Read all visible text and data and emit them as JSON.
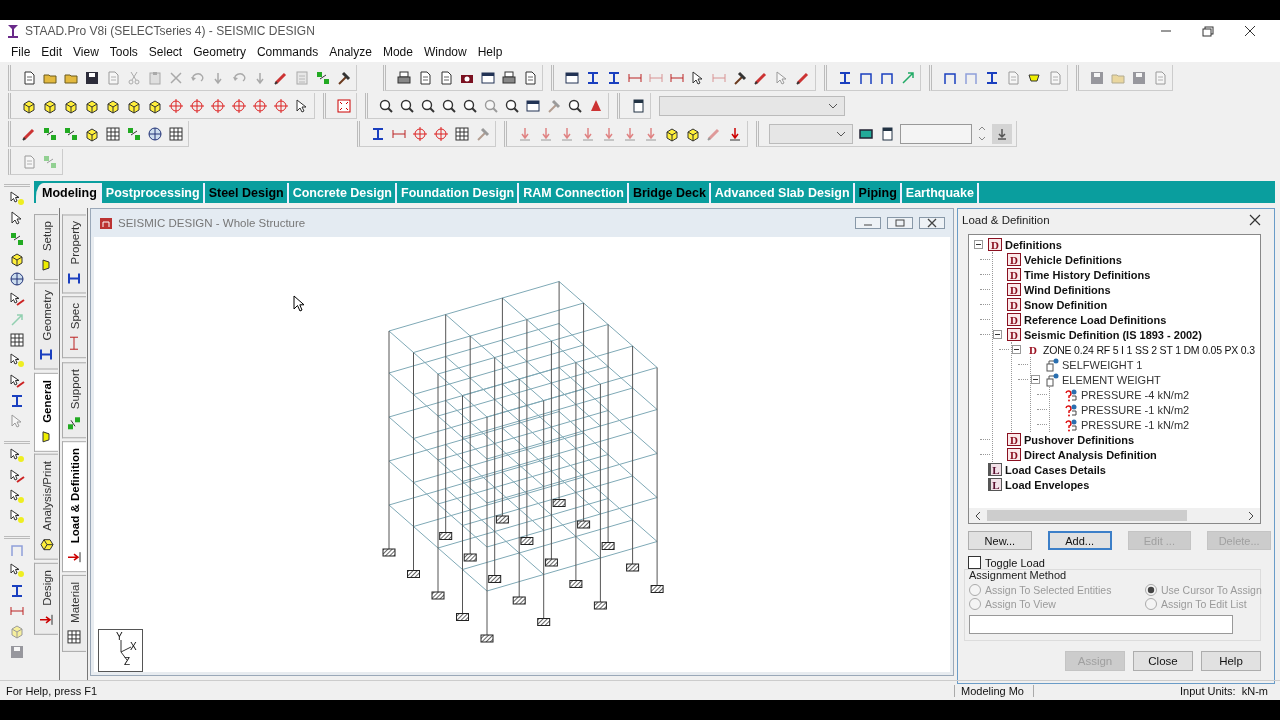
{
  "window": {
    "title": "STAAD.Pro V8i (SELECTseries 4) - SEISMIC DESIGN"
  },
  "menu": [
    "File",
    "Edit",
    "View",
    "Tools",
    "Select",
    "Geometry",
    "Commands",
    "Analyze",
    "Mode",
    "Window",
    "Help"
  ],
  "page_tabs": [
    {
      "label": "Modeling",
      "selected": true,
      "dark_label": true
    },
    {
      "label": "Postprocessing",
      "selected": false,
      "dark_label": false
    },
    {
      "label": "Steel Design",
      "selected": false,
      "dark_label": true
    },
    {
      "label": "Concrete Design",
      "selected": false,
      "dark_label": false
    },
    {
      "label": "Foundation Design",
      "selected": false,
      "dark_label": false
    },
    {
      "label": "RAM Connection",
      "selected": false,
      "dark_label": false
    },
    {
      "label": "Bridge Deck",
      "selected": false,
      "dark_label": true
    },
    {
      "label": "Advanced Slab Design",
      "selected": false,
      "dark_label": false
    },
    {
      "label": "Piping",
      "selected": false,
      "dark_label": true
    },
    {
      "label": "Earthquake",
      "selected": false,
      "dark_label": false
    }
  ],
  "mode_tabs": [
    {
      "label": "Setup",
      "selected": false
    },
    {
      "label": "Geometry",
      "selected": false
    },
    {
      "label": "General",
      "selected": true
    },
    {
      "label": "Analysis/Print",
      "selected": false
    },
    {
      "label": "Design",
      "selected": false
    }
  ],
  "sub_tabs": [
    {
      "label": "Property",
      "selected": false
    },
    {
      "label": "Spec",
      "selected": false
    },
    {
      "label": "Support",
      "selected": false
    },
    {
      "label": "Load & Definition",
      "selected": true
    },
    {
      "label": "Material",
      "selected": false
    }
  ],
  "viewport": {
    "title": "SEISMIC DESIGN - Whole Structure",
    "axis_labels": [
      "Y",
      "X",
      "Z"
    ]
  },
  "panel": {
    "title": "Load & Definition",
    "tree": [
      {
        "label": "Definitions",
        "kind": "definition",
        "badge": "D",
        "expanded": true,
        "children": [
          {
            "label": "Vehicle Definitions",
            "kind": "definition",
            "badge": "D"
          },
          {
            "label": "Time History Definitions",
            "kind": "definition",
            "badge": "D"
          },
          {
            "label": "Wind Definitions",
            "kind": "definition",
            "badge": "D"
          },
          {
            "label": "Snow Definition",
            "kind": "definition",
            "badge": "D"
          },
          {
            "label": "Reference Load Definitions",
            "kind": "definition",
            "badge": "D"
          },
          {
            "label": "Seismic Definition (IS 1893 - 2002)",
            "kind": "definition",
            "badge": "D",
            "expanded": true,
            "children": [
              {
                "label": "ZONE 0.24 RF 5 I 1 SS 2 ST 1 DM 0.05 PX 0.3",
                "kind": "parameter",
                "badge": "D",
                "expanded": true,
                "children": [
                  {
                    "label": "SELFWEIGHT 1",
                    "kind": "load"
                  },
                  {
                    "label": "ELEMENT WEIGHT",
                    "kind": "load",
                    "expanded": true,
                    "children": [
                      {
                        "label": "PRESSURE -4 kN/m2",
                        "kind": "pressure"
                      },
                      {
                        "label": "PRESSURE -1 kN/m2",
                        "kind": "pressure"
                      },
                      {
                        "label": "PRESSURE -1 kN/m2",
                        "kind": "pressure"
                      }
                    ]
                  }
                ]
              }
            ]
          },
          {
            "label": "Pushover Definitions",
            "kind": "definition",
            "badge": "D"
          },
          {
            "label": "Direct Analysis Definition",
            "kind": "definition",
            "badge": "D"
          }
        ]
      },
      {
        "label": "Load Cases Details",
        "kind": "group",
        "badge": "L"
      },
      {
        "label": "Load Envelopes",
        "kind": "group",
        "badge": "L"
      }
    ],
    "buttons": [
      {
        "label": "New...",
        "disabled": false,
        "focused": false
      },
      {
        "label": "Add...",
        "disabled": false,
        "focused": true
      },
      {
        "label": "Edit ...",
        "disabled": true,
        "focused": false
      },
      {
        "label": "Delete...",
        "disabled": true,
        "focused": false
      }
    ],
    "toggle": {
      "label": "Toggle Load",
      "checked": false
    },
    "group_title": "Assignment Method",
    "radios": [
      {
        "label": "Assign To Selected Entities",
        "selected": false,
        "disabled": true
      },
      {
        "label": "Use Cursor To Assign",
        "selected": true,
        "disabled": true
      },
      {
        "label": "Assign To View",
        "selected": false,
        "disabled": true
      },
      {
        "label": "Assign To Edit List",
        "selected": false,
        "disabled": true
      }
    ],
    "footer_buttons": [
      {
        "label": "Assign",
        "disabled": true
      },
      {
        "label": "Close",
        "disabled": false
      },
      {
        "label": "Help",
        "disabled": false
      }
    ]
  },
  "status_bar": [
    "For Help, press F1",
    "Modeling Mo",
    "Input Units:  kN-m"
  ]
}
